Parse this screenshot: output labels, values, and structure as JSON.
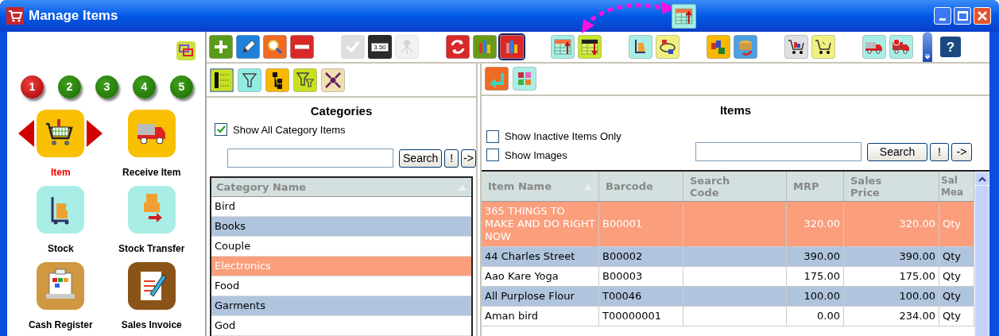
{
  "window": {
    "title": "Manage Items"
  },
  "toolbar": [
    {
      "kind": "add",
      "disabled": false,
      "selected": false
    },
    {
      "kind": "edit",
      "disabled": false,
      "selected": false
    },
    {
      "kind": "find",
      "disabled": false,
      "selected": false
    },
    {
      "kind": "delete",
      "disabled": false,
      "selected": false
    },
    {
      "kind": "gap"
    },
    {
      "kind": "check",
      "disabled": true,
      "selected": false
    },
    {
      "kind": "price",
      "label": "3.50",
      "disabled": false,
      "selected": false
    },
    {
      "kind": "network",
      "disabled": true,
      "selected": false
    },
    {
      "kind": "gap"
    },
    {
      "kind": "refresh",
      "disabled": false,
      "selected": false
    },
    {
      "kind": "chart-green",
      "disabled": false,
      "selected": false
    },
    {
      "kind": "chart-red",
      "disabled": false,
      "selected": true
    },
    {
      "kind": "gap"
    },
    {
      "kind": "table-up",
      "disabled": false,
      "selected": false
    },
    {
      "kind": "table-down",
      "disabled": false,
      "selected": false
    },
    {
      "kind": "gap"
    },
    {
      "kind": "stock",
      "disabled": false,
      "selected": false
    },
    {
      "kind": "transfer",
      "disabled": false,
      "selected": false
    },
    {
      "kind": "gap"
    },
    {
      "kind": "boxes",
      "disabled": false,
      "selected": false
    },
    {
      "kind": "coins",
      "disabled": false,
      "selected": false
    },
    {
      "kind": "gap"
    },
    {
      "kind": "cart-grey",
      "disabled": false,
      "selected": false
    },
    {
      "kind": "cart-yellow",
      "disabled": false,
      "selected": false
    },
    {
      "kind": "gap"
    },
    {
      "kind": "truck",
      "disabled": false,
      "selected": false
    },
    {
      "kind": "truck-return",
      "disabled": false,
      "selected": false
    },
    {
      "kind": "more",
      "disabled": false,
      "selected": false
    },
    {
      "kind": "help",
      "label": "?",
      "disabled": false,
      "selected": false
    }
  ],
  "sidebar": {
    "pages": [
      {
        "label": "1",
        "selected": true
      },
      {
        "label": "2",
        "selected": false
      },
      {
        "label": "3",
        "selected": false
      },
      {
        "label": "4",
        "selected": false
      },
      {
        "label": "5",
        "selected": false
      }
    ],
    "items": [
      {
        "kind": "item",
        "label": "Item",
        "selected": true
      },
      {
        "kind": "receive",
        "label": "Receive Item",
        "selected": false
      },
      {
        "kind": "stock",
        "label": "Stock",
        "selected": false
      },
      {
        "kind": "transfer",
        "label": "Stock Transfer",
        "selected": false
      },
      {
        "kind": "register",
        "label": "Cash Register",
        "selected": false
      },
      {
        "kind": "invoice",
        "label": "Sales Invoice",
        "selected": false
      }
    ]
  },
  "categories": {
    "tools": [
      {
        "kind": "tree",
        "selected": true
      },
      {
        "kind": "filter",
        "selected": false
      },
      {
        "kind": "hierarchy",
        "selected": false
      },
      {
        "kind": "filter2",
        "selected": false
      },
      {
        "kind": "collapse",
        "selected": false
      }
    ],
    "title": "Categories",
    "show_all": {
      "label": "Show All Category Items",
      "checked": true
    },
    "buttons": [
      "Search",
      "!",
      "->"
    ],
    "column": "Category Name",
    "rows": [
      {
        "name": "Bird",
        "selected": false
      },
      {
        "name": "Books",
        "selected": false
      },
      {
        "name": "Couple",
        "selected": false
      },
      {
        "name": "Electronics",
        "selected": true
      },
      {
        "name": "Food",
        "selected": false
      },
      {
        "name": "Garments",
        "selected": false
      },
      {
        "name": "God",
        "selected": false
      }
    ]
  },
  "items": {
    "tools": [
      {
        "kind": "back",
        "selected": false
      },
      {
        "kind": "tiles",
        "selected": false
      }
    ],
    "title": "Items",
    "options": [
      {
        "label": "Show Inactive Items Only",
        "checked": false
      },
      {
        "label": "Show Images",
        "checked": false
      }
    ],
    "buttons": [
      "Search",
      "!",
      "->"
    ],
    "columns": [
      "Item Name",
      "Barcode",
      "Search Code",
      "MRP",
      "Sales Price",
      "Sal Mea"
    ],
    "rows": [
      {
        "cells": [
          "365 THINGS TO MAKE AND DO RIGHT NOW",
          "B00001",
          "",
          "320.00",
          "320.00",
          "Qty"
        ],
        "selected": true
      },
      {
        "cells": [
          "44 Charles Street",
          "B00002",
          "",
          "390.00",
          "390.00",
          "Qty"
        ],
        "selected": false
      },
      {
        "cells": [
          "Aao Kare Yoga",
          "B00003",
          "",
          "175.00",
          "175.00",
          "Qty"
        ],
        "selected": false
      },
      {
        "cells": [
          "All Purplose Flour",
          "T00046",
          "",
          "100.00",
          "100.00",
          "Qty"
        ],
        "selected": false
      },
      {
        "cells": [
          "Aman bird",
          "T00000001",
          "",
          "0.00",
          "234.00",
          "Qty"
        ],
        "selected": false
      }
    ]
  }
}
